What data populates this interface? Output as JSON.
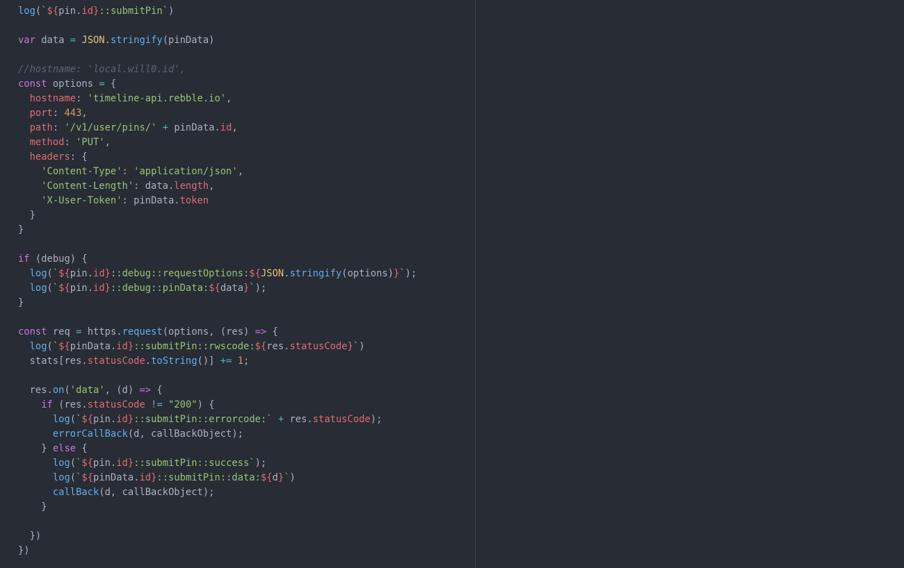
{
  "colors": {
    "background": "#282c34",
    "ruler": "#3b4048",
    "plain": "#abb2bf",
    "keyword": "#c678dd",
    "function": "#61afef",
    "property": "#e06c75",
    "string": "#98c379",
    "number": "#d19a66",
    "object": "#e5c07b",
    "operator": "#56b6c2",
    "comment": "#5c6370"
  },
  "code_lines": [
    [
      {
        "t": "fn",
        "v": "log"
      },
      {
        "t": "plain",
        "v": "("
      },
      {
        "t": "str",
        "v": "`"
      },
      {
        "t": "tpl",
        "v": "${"
      },
      {
        "t": "plain",
        "v": "pin."
      },
      {
        "t": "prop",
        "v": "id"
      },
      {
        "t": "tpl",
        "v": "}"
      },
      {
        "t": "str",
        "v": "::submitPin`"
      },
      {
        "t": "plain",
        "v": ")"
      }
    ],
    [],
    [
      {
        "t": "kw",
        "v": "var"
      },
      {
        "t": "plain",
        "v": " data "
      },
      {
        "t": "op",
        "v": "="
      },
      {
        "t": "plain",
        "v": " "
      },
      {
        "t": "obj",
        "v": "JSON"
      },
      {
        "t": "plain",
        "v": "."
      },
      {
        "t": "fn",
        "v": "stringify"
      },
      {
        "t": "plain",
        "v": "(pinData)"
      }
    ],
    [],
    [
      {
        "t": "cmt",
        "v": "//hostname: 'local.will0.id',"
      }
    ],
    [
      {
        "t": "kw",
        "v": "const"
      },
      {
        "t": "plain",
        "v": " options "
      },
      {
        "t": "op",
        "v": "="
      },
      {
        "t": "plain",
        "v": " {"
      }
    ],
    [
      {
        "t": "plain",
        "v": "  "
      },
      {
        "t": "prop",
        "v": "hostname"
      },
      {
        "t": "plain",
        "v": ": "
      },
      {
        "t": "str",
        "v": "'timeline-api.rebble.io'"
      },
      {
        "t": "plain",
        "v": ","
      }
    ],
    [
      {
        "t": "plain",
        "v": "  "
      },
      {
        "t": "prop",
        "v": "port"
      },
      {
        "t": "plain",
        "v": ": "
      },
      {
        "t": "num",
        "v": "443"
      },
      {
        "t": "plain",
        "v": ","
      }
    ],
    [
      {
        "t": "plain",
        "v": "  "
      },
      {
        "t": "prop",
        "v": "path"
      },
      {
        "t": "plain",
        "v": ": "
      },
      {
        "t": "str",
        "v": "'/v1/user/pins/'"
      },
      {
        "t": "plain",
        "v": " "
      },
      {
        "t": "op",
        "v": "+"
      },
      {
        "t": "plain",
        "v": " pinData."
      },
      {
        "t": "prop",
        "v": "id"
      },
      {
        "t": "plain",
        "v": ","
      }
    ],
    [
      {
        "t": "plain",
        "v": "  "
      },
      {
        "t": "prop",
        "v": "method"
      },
      {
        "t": "plain",
        "v": ": "
      },
      {
        "t": "str",
        "v": "'PUT'"
      },
      {
        "t": "plain",
        "v": ","
      }
    ],
    [
      {
        "t": "plain",
        "v": "  "
      },
      {
        "t": "prop",
        "v": "headers"
      },
      {
        "t": "plain",
        "v": ": {"
      }
    ],
    [
      {
        "t": "plain",
        "v": "    "
      },
      {
        "t": "str",
        "v": "'Content-Type'"
      },
      {
        "t": "plain",
        "v": ": "
      },
      {
        "t": "str",
        "v": "'application/json'"
      },
      {
        "t": "plain",
        "v": ","
      }
    ],
    [
      {
        "t": "plain",
        "v": "    "
      },
      {
        "t": "str",
        "v": "'Content-Length'"
      },
      {
        "t": "plain",
        "v": ": data."
      },
      {
        "t": "prop",
        "v": "length"
      },
      {
        "t": "plain",
        "v": ","
      }
    ],
    [
      {
        "t": "plain",
        "v": "    "
      },
      {
        "t": "str",
        "v": "'X-User-Token'"
      },
      {
        "t": "plain",
        "v": ": pinData."
      },
      {
        "t": "prop",
        "v": "token"
      }
    ],
    [
      {
        "t": "plain",
        "v": "  }"
      }
    ],
    [
      {
        "t": "plain",
        "v": "}"
      }
    ],
    [],
    [
      {
        "t": "kw",
        "v": "if"
      },
      {
        "t": "plain",
        "v": " (debug) {"
      }
    ],
    [
      {
        "t": "plain",
        "v": "  "
      },
      {
        "t": "fn",
        "v": "log"
      },
      {
        "t": "plain",
        "v": "("
      },
      {
        "t": "str",
        "v": "`"
      },
      {
        "t": "tpl",
        "v": "${"
      },
      {
        "t": "plain",
        "v": "pin."
      },
      {
        "t": "prop",
        "v": "id"
      },
      {
        "t": "tpl",
        "v": "}"
      },
      {
        "t": "str",
        "v": "::debug::requestOptions:"
      },
      {
        "t": "tpl",
        "v": "${"
      },
      {
        "t": "obj",
        "v": "JSON"
      },
      {
        "t": "plain",
        "v": "."
      },
      {
        "t": "fn",
        "v": "stringify"
      },
      {
        "t": "plain",
        "v": "(options)"
      },
      {
        "t": "tpl",
        "v": "}"
      },
      {
        "t": "str",
        "v": "`"
      },
      {
        "t": "plain",
        "v": ");"
      }
    ],
    [
      {
        "t": "plain",
        "v": "  "
      },
      {
        "t": "fn",
        "v": "log"
      },
      {
        "t": "plain",
        "v": "("
      },
      {
        "t": "str",
        "v": "`"
      },
      {
        "t": "tpl",
        "v": "${"
      },
      {
        "t": "plain",
        "v": "pin."
      },
      {
        "t": "prop",
        "v": "id"
      },
      {
        "t": "tpl",
        "v": "}"
      },
      {
        "t": "str",
        "v": "::debug::pinData:"
      },
      {
        "t": "tpl",
        "v": "${"
      },
      {
        "t": "plain",
        "v": "data"
      },
      {
        "t": "tpl",
        "v": "}"
      },
      {
        "t": "str",
        "v": "`"
      },
      {
        "t": "plain",
        "v": ");"
      }
    ],
    [
      {
        "t": "plain",
        "v": "}"
      }
    ],
    [],
    [
      {
        "t": "kw",
        "v": "const"
      },
      {
        "t": "plain",
        "v": " req "
      },
      {
        "t": "op",
        "v": "="
      },
      {
        "t": "plain",
        "v": " https."
      },
      {
        "t": "fn",
        "v": "request"
      },
      {
        "t": "plain",
        "v": "(options, (res) "
      },
      {
        "t": "kw",
        "v": "=>"
      },
      {
        "t": "plain",
        "v": " {"
      }
    ],
    [
      {
        "t": "plain",
        "v": "  "
      },
      {
        "t": "fn",
        "v": "log"
      },
      {
        "t": "plain",
        "v": "("
      },
      {
        "t": "str",
        "v": "`"
      },
      {
        "t": "tpl",
        "v": "${"
      },
      {
        "t": "plain",
        "v": "pinData."
      },
      {
        "t": "prop",
        "v": "id"
      },
      {
        "t": "tpl",
        "v": "}"
      },
      {
        "t": "str",
        "v": "::submitPin::rwscode:"
      },
      {
        "t": "tpl",
        "v": "${"
      },
      {
        "t": "plain",
        "v": "res."
      },
      {
        "t": "prop",
        "v": "statusCode"
      },
      {
        "t": "tpl",
        "v": "}"
      },
      {
        "t": "str",
        "v": "`"
      },
      {
        "t": "plain",
        "v": ")"
      }
    ],
    [
      {
        "t": "plain",
        "v": "  stats[res."
      },
      {
        "t": "prop",
        "v": "statusCode"
      },
      {
        "t": "plain",
        "v": "."
      },
      {
        "t": "fn",
        "v": "toString"
      },
      {
        "t": "plain",
        "v": "()] "
      },
      {
        "t": "op",
        "v": "+="
      },
      {
        "t": "plain",
        "v": " "
      },
      {
        "t": "num",
        "v": "1"
      },
      {
        "t": "plain",
        "v": ";"
      }
    ],
    [],
    [
      {
        "t": "plain",
        "v": "  res."
      },
      {
        "t": "fn",
        "v": "on"
      },
      {
        "t": "plain",
        "v": "("
      },
      {
        "t": "str",
        "v": "'data'"
      },
      {
        "t": "plain",
        "v": ", (d) "
      },
      {
        "t": "kw",
        "v": "=>"
      },
      {
        "t": "plain",
        "v": " {"
      }
    ],
    [
      {
        "t": "plain",
        "v": "    "
      },
      {
        "t": "kw",
        "v": "if"
      },
      {
        "t": "plain",
        "v": " (res."
      },
      {
        "t": "prop",
        "v": "statusCode"
      },
      {
        "t": "plain",
        "v": " "
      },
      {
        "t": "op",
        "v": "!="
      },
      {
        "t": "plain",
        "v": " "
      },
      {
        "t": "str",
        "v": "\"200\""
      },
      {
        "t": "plain",
        "v": ") {"
      }
    ],
    [
      {
        "t": "plain",
        "v": "      "
      },
      {
        "t": "fn",
        "v": "log"
      },
      {
        "t": "plain",
        "v": "("
      },
      {
        "t": "str",
        "v": "`"
      },
      {
        "t": "tpl",
        "v": "${"
      },
      {
        "t": "plain",
        "v": "pin."
      },
      {
        "t": "prop",
        "v": "id"
      },
      {
        "t": "tpl",
        "v": "}"
      },
      {
        "t": "str",
        "v": "::submitPin::errorcode:`"
      },
      {
        "t": "plain",
        "v": " "
      },
      {
        "t": "op",
        "v": "+"
      },
      {
        "t": "plain",
        "v": " res."
      },
      {
        "t": "prop",
        "v": "statusCode"
      },
      {
        "t": "plain",
        "v": ");"
      }
    ],
    [
      {
        "t": "plain",
        "v": "      "
      },
      {
        "t": "fn",
        "v": "errorCallBack"
      },
      {
        "t": "plain",
        "v": "(d, callBackObject);"
      }
    ],
    [
      {
        "t": "plain",
        "v": "    } "
      },
      {
        "t": "kw",
        "v": "else"
      },
      {
        "t": "plain",
        "v": " {"
      }
    ],
    [
      {
        "t": "plain",
        "v": "      "
      },
      {
        "t": "fn",
        "v": "log"
      },
      {
        "t": "plain",
        "v": "("
      },
      {
        "t": "str",
        "v": "`"
      },
      {
        "t": "tpl",
        "v": "${"
      },
      {
        "t": "plain",
        "v": "pin."
      },
      {
        "t": "prop",
        "v": "id"
      },
      {
        "t": "tpl",
        "v": "}"
      },
      {
        "t": "str",
        "v": "::submitPin::success`"
      },
      {
        "t": "plain",
        "v": ");"
      }
    ],
    [
      {
        "t": "plain",
        "v": "      "
      },
      {
        "t": "fn",
        "v": "log"
      },
      {
        "t": "plain",
        "v": "("
      },
      {
        "t": "str",
        "v": "`"
      },
      {
        "t": "tpl",
        "v": "${"
      },
      {
        "t": "plain",
        "v": "pinData."
      },
      {
        "t": "prop",
        "v": "id"
      },
      {
        "t": "tpl",
        "v": "}"
      },
      {
        "t": "str",
        "v": "::submitPin::data:"
      },
      {
        "t": "tpl",
        "v": "${"
      },
      {
        "t": "plain",
        "v": "d"
      },
      {
        "t": "tpl",
        "v": "}"
      },
      {
        "t": "str",
        "v": "`"
      },
      {
        "t": "plain",
        "v": ")"
      }
    ],
    [
      {
        "t": "plain",
        "v": "      "
      },
      {
        "t": "fn",
        "v": "callBack"
      },
      {
        "t": "plain",
        "v": "(d, callBackObject);"
      }
    ],
    [
      {
        "t": "plain",
        "v": "    }"
      }
    ],
    [],
    [
      {
        "t": "plain",
        "v": "  })"
      }
    ],
    [
      {
        "t": "plain",
        "v": "})"
      }
    ]
  ]
}
